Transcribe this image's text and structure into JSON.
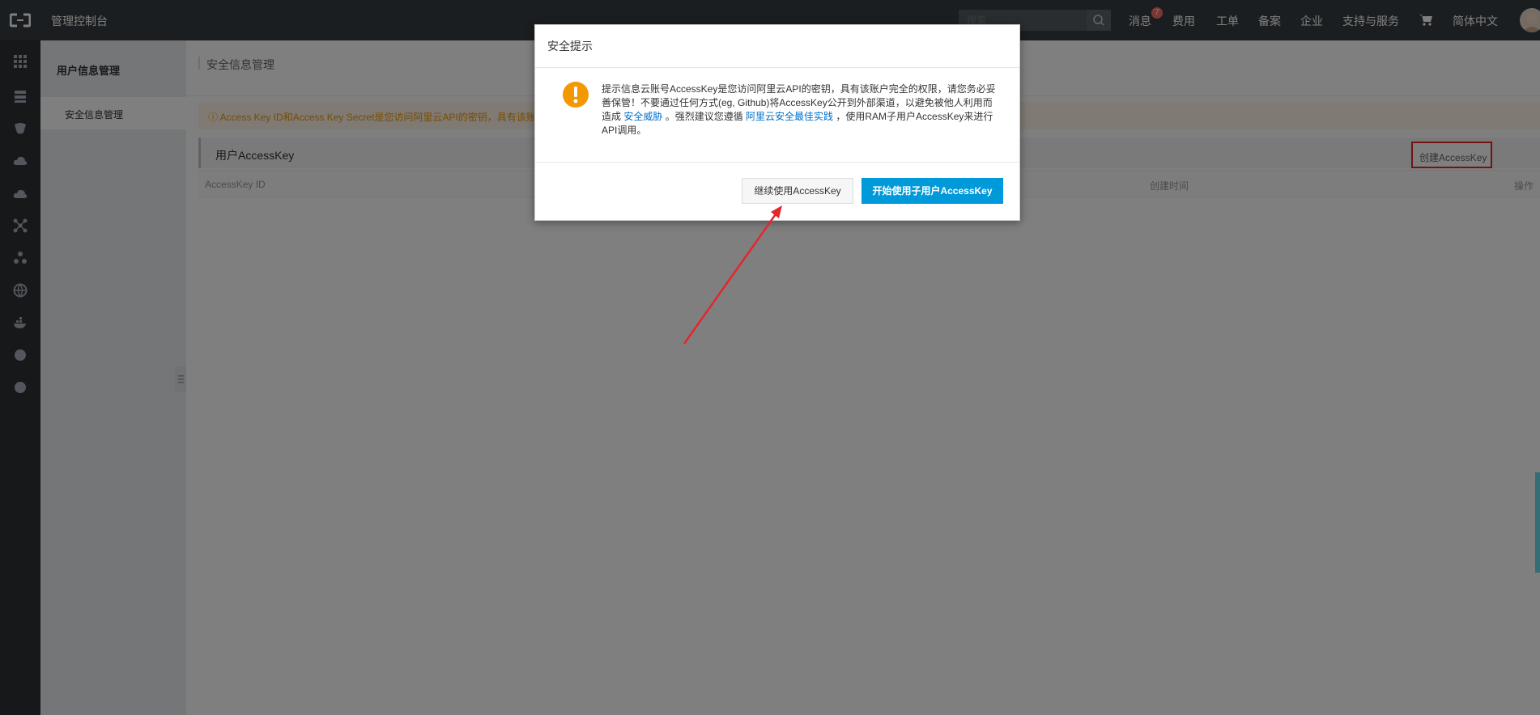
{
  "header": {
    "console_title": "管理控制台",
    "search_placeholder": "搜索",
    "nav": {
      "messages": "消息",
      "messages_badge": "7",
      "billing": "费用",
      "tickets": "工单",
      "icp": "备案",
      "enterprise": "企业",
      "support": "支持与服务",
      "language": "简体中文"
    }
  },
  "sidebar": {
    "section_title": "用户信息管理",
    "items": [
      {
        "label": "安全信息管理"
      }
    ]
  },
  "main": {
    "breadcrumb": "安全信息管理",
    "notice": "ⓘ Access Key ID和Access Key Secret是您访问阿里云API的密钥，具有该账",
    "panel_title": "用户AccessKey",
    "create_button": "创建AccessKey",
    "table_headers": {
      "access_key_id": "AccessKey ID",
      "created_time": "创建时间",
      "actions": "操作"
    }
  },
  "dialog": {
    "title": "安全提示",
    "message_part1": "提示信息云账号AccessKey是您访问阿里云API的密钥，具有该账户完全的权限，请您务必妥善保管！不要通过任何方式(eg, Github)将AccessKey公开到外部渠道，以避免被他人利用而造成 ",
    "link1": "安全威胁",
    "message_part2": " 。强烈建议您遵循 ",
    "link2": "阿里云安全最佳实践",
    "message_part3": " ，使用RAM子用户AccessKey来进行API调用。",
    "continue_button": "继续使用AccessKey",
    "start_button": "开始使用子用户AccessKey"
  },
  "colors": {
    "topbar": "#373d41",
    "primary_button": "#0099d9",
    "warning": "#f39800",
    "highlight_box": "#e4262d",
    "annotation_arrow": "#e4262d"
  }
}
